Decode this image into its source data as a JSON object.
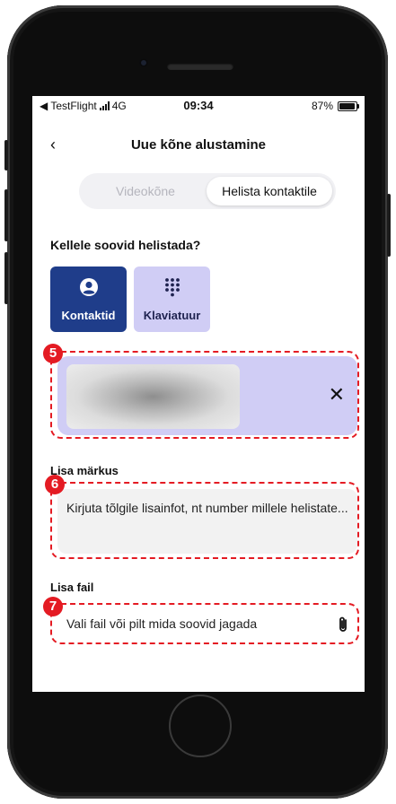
{
  "status_bar": {
    "carrier": "◀ TestFlight",
    "network": "4G",
    "time": "09:34",
    "battery": "87%",
    "battery_level": 0.87
  },
  "header": {
    "back_label": "‹",
    "title": "Uue kõne alustamine"
  },
  "segmented": {
    "options": [
      "Videokõne",
      "Helista kontaktile"
    ],
    "selected": "Helista kontaktile"
  },
  "question": "Kellele soovid helistada?",
  "modes": [
    {
      "label": "Kontaktid",
      "icon": "person-circle-icon",
      "selected": true
    },
    {
      "label": "Klaviatuur",
      "icon": "dialpad-icon",
      "selected": false
    }
  ],
  "selected_contact": {
    "close_label": "✕"
  },
  "note": {
    "label": "Lisa märkus",
    "placeholder": "Kirjuta tõlgile lisainfot, nt number millele helistate..."
  },
  "file": {
    "label": "Lisa fail",
    "placeholder": "Vali fail või pilt mida soovid jagada",
    "icon": "paperclip-icon"
  },
  "annotations": {
    "badges": [
      "5",
      "6",
      "7"
    ],
    "color": "#e41b23"
  },
  "colors": {
    "primary": "#1f3d8a",
    "accent_light": "#d0cdf5"
  }
}
